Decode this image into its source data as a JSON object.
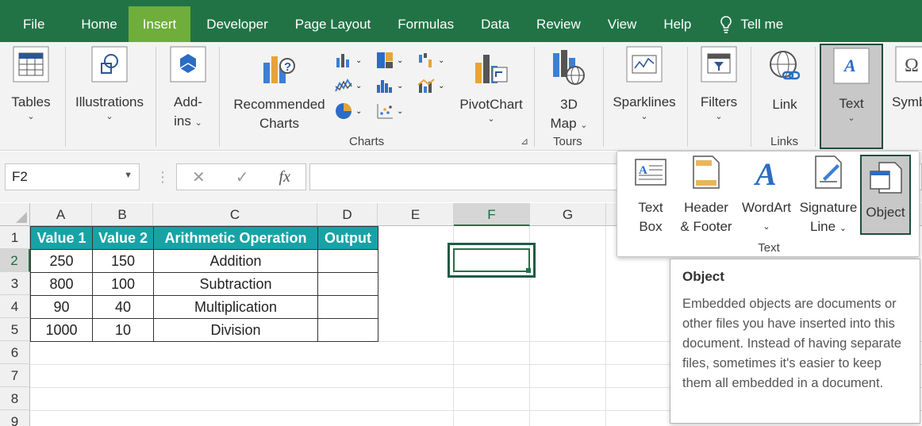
{
  "menu": {
    "tabs": [
      "File",
      "Home",
      "Insert",
      "Developer",
      "Page Layout",
      "Formulas",
      "Data",
      "Review",
      "View",
      "Help"
    ],
    "active_tab": "Insert",
    "tell_me": "Tell me"
  },
  "ribbon": {
    "tables": "Tables",
    "illustrations": "Illustrations",
    "addins_1": "Add-",
    "addins_2": "ins",
    "recommended_1": "Recommended",
    "recommended_2": "Charts",
    "pivotchart": "PivotChart",
    "map_1": "3D",
    "map_2": "Map",
    "sparklines": "Sparklines",
    "filters": "Filters",
    "link": "Link",
    "text": "Text",
    "symbols": "Symb",
    "group_charts": "Charts",
    "group_tours": "Tours",
    "group_links": "Links"
  },
  "formula_bar": {
    "name_box": "F2",
    "fx": "fx",
    "formula": ""
  },
  "columns": [
    "A",
    "B",
    "C",
    "D",
    "E",
    "F",
    "G"
  ],
  "selected_column": "F",
  "rows": [
    "1",
    "2",
    "3",
    "4",
    "5",
    "6",
    "7",
    "8",
    "9"
  ],
  "selected_row": "2",
  "table": {
    "headers": [
      "Value 1",
      "Value 2",
      "Arithmetic Operation",
      "Output"
    ],
    "rows": [
      [
        "250",
        "150",
        "Addition",
        ""
      ],
      [
        "800",
        "100",
        "Subtraction",
        ""
      ],
      [
        "90",
        "40",
        "Multiplication",
        ""
      ],
      [
        "1000",
        "10",
        "Division",
        ""
      ]
    ]
  },
  "text_panel": {
    "text_box_1": "Text",
    "text_box_2": "Box",
    "header_1": "Header",
    "header_2": "& Footer",
    "wordart": "WordArt",
    "signature_1": "Signature",
    "signature_2": "Line",
    "object": "Object",
    "group_label": "Text"
  },
  "tooltip": {
    "title": "Object",
    "body": "Embedded objects are documents or other files you have inserted into this document. Instead of having separate files, sometimes it's easier to keep them all embedded in a document."
  },
  "colors": {
    "excel_green": "#217346",
    "active_tab": "#6fae3a",
    "header_fill": "#17a3a6"
  }
}
